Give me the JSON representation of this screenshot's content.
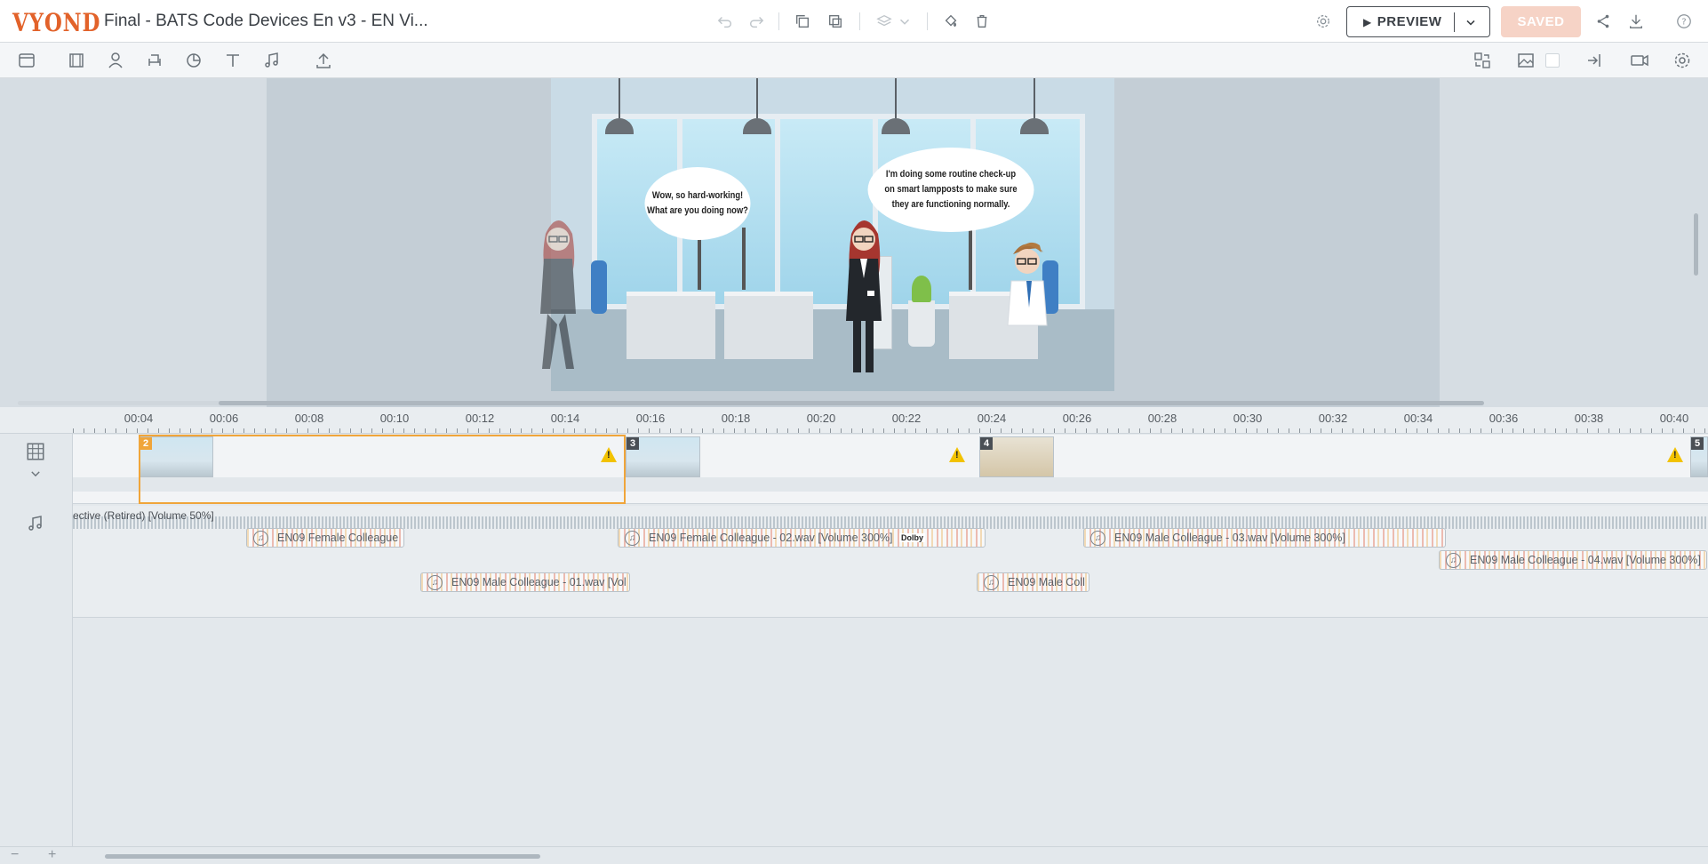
{
  "app": {
    "logo": "VYOND",
    "title": "Final - BATS Code Devices En v3 - EN Vi..."
  },
  "header": {
    "preview_label": "PREVIEW",
    "saved_label": "SAVED"
  },
  "icons": {
    "undo": "undo-icon",
    "redo": "redo-icon",
    "copy": "copy-icon",
    "paste": "paste-icon",
    "layers": "layers-icon",
    "paint": "paint-bucket-icon",
    "delete": "trash-icon",
    "settings": "gear-icon",
    "share": "share-icon",
    "download": "download-icon",
    "help": "help-icon"
  },
  "stage": {
    "bubble_left": "Wow, so hard-working! What are you doing now?",
    "bubble_right": "I'm doing some routine check-up on smart lampposts to make sure they are functioning normally."
  },
  "timeline": {
    "ticks": [
      "00:04",
      "00:06",
      "00:08",
      "00:10",
      "00:12",
      "00:14",
      "00:16",
      "00:18",
      "00:20",
      "00:22",
      "00:24",
      "00:26",
      "00:28",
      "00:30",
      "00:32",
      "00:34",
      "00:36",
      "00:38",
      "00:40"
    ],
    "scenes": [
      {
        "num": "2",
        "selected": true
      },
      {
        "num": "3",
        "selected": false
      },
      {
        "num": "4",
        "selected": false
      },
      {
        "num": "5",
        "selected": false
      }
    ],
    "background_music": "ective (Retired) [Volume 50%]",
    "clips": [
      {
        "label": "EN09 Female Colleague"
      },
      {
        "label": "EN09 Female Colleague - 02.wav [Volume 300%]"
      },
      {
        "label": "EN09 Male Colleague - 03.wav [Volume 300%]"
      },
      {
        "label": "EN09 Male Colleague - 04.wav [Volume 300%]"
      },
      {
        "label": "EN09 Male Colleague - 01.wav [Vol"
      },
      {
        "label": "EN09 Male Coll"
      }
    ],
    "dolby": "Dolby"
  },
  "bottom": {
    "zoom_out": "−",
    "zoom_in": "+"
  }
}
